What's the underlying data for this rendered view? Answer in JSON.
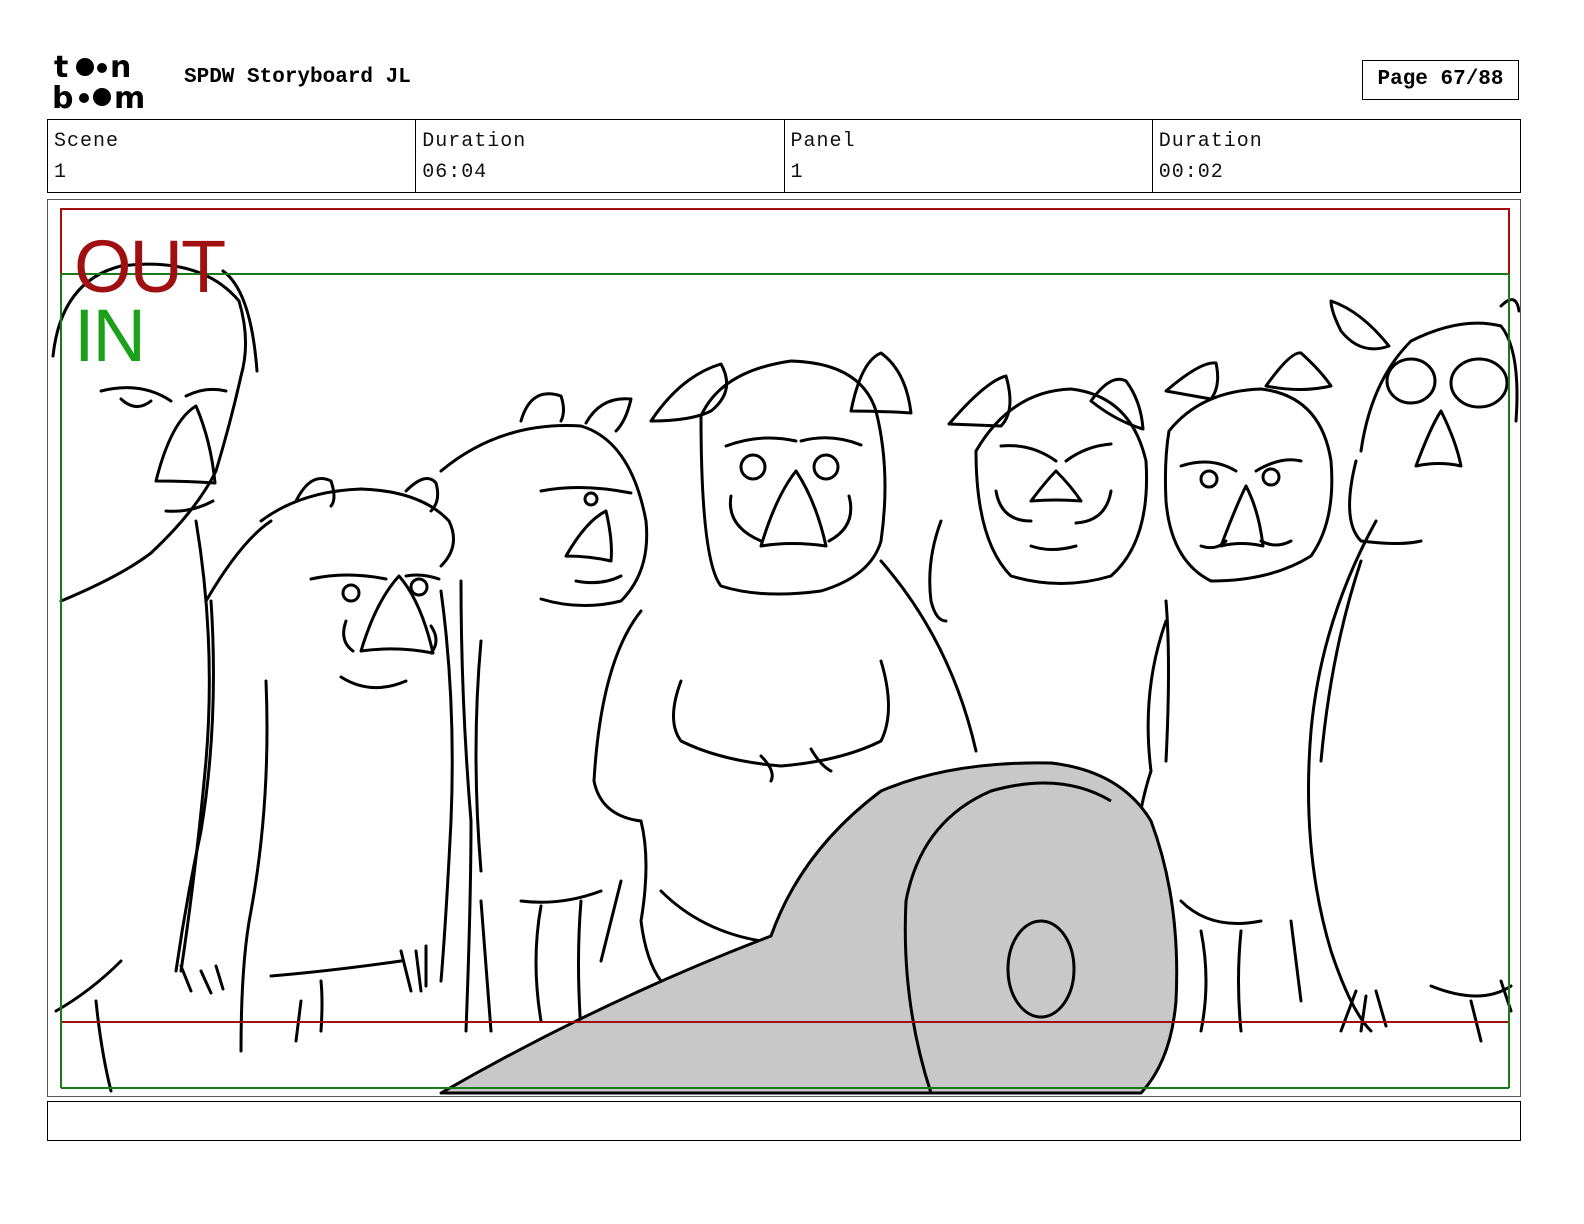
{
  "header": {
    "logo": {
      "line1": "toon",
      "line2": "boom",
      "name": "toon-boom-logo"
    },
    "title": "SPDW Storyboard JL",
    "page": "Page 67/88"
  },
  "info": {
    "scene_label": "Scene",
    "scene_value": "1",
    "scene_duration_label": "Duration",
    "scene_duration_value": "06:04",
    "panel_label": "Panel",
    "panel_value": "1",
    "panel_duration_label": "Duration",
    "panel_duration_value": "00:02"
  },
  "panel": {
    "out_label": "OUT",
    "in_label": "IN",
    "out_color": "#a01010",
    "in_color": "#1aa01a",
    "drawing": "line sketch of boar characters standing behind a large rolled object"
  },
  "notes": {
    "text": ""
  }
}
